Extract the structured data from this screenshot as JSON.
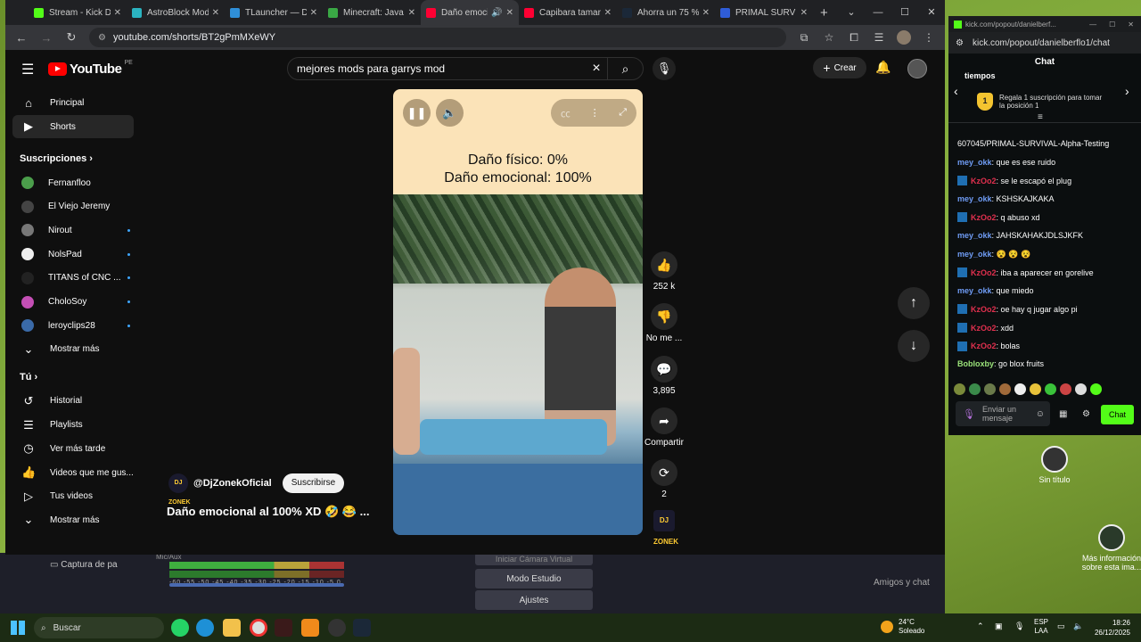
{
  "browser": {
    "tabs": [
      {
        "label": "Stream - Kick Das",
        "color": "#53fc18"
      },
      {
        "label": "AstroBlock ModPa",
        "color": "#2bb3c0"
      },
      {
        "label": "TLauncher — Do",
        "color": "#2f8fd8"
      },
      {
        "label": "Minecraft: Java y",
        "color": "#3aa845"
      },
      {
        "label": "Daño emocio",
        "color": "#ff0033",
        "active": true
      },
      {
        "label": "Capibara tamaras",
        "color": "#ff0033"
      },
      {
        "label": "Ahorra un 75 % e",
        "color": "#1b2838"
      },
      {
        "label": "PRIMAL SURV",
        "color": "#2f5dd8"
      }
    ],
    "url": "youtube.com/shorts/BT2gPmMXeWY"
  },
  "youtube": {
    "logo_text": "YouTube",
    "country": "PE",
    "search_query": "mejores mods para garrys mod",
    "create_label": "Crear",
    "sidebar": {
      "main": [
        {
          "label": "Principal",
          "icon": "home-icon"
        },
        {
          "label": "Shorts",
          "icon": "shorts-icon",
          "active": true
        }
      ],
      "subs_heading": "Suscripciones",
      "subs": [
        {
          "label": "Fernanfloo",
          "color": "#4b9e4b",
          "live": false
        },
        {
          "label": "El Viejo Jeremy",
          "color": "#444444",
          "live": false
        },
        {
          "label": "Nirout",
          "color": "#777777",
          "live": true
        },
        {
          "label": "NolsPad",
          "color": "#eeeeee",
          "live": true
        },
        {
          "label": "TITANS of CNC ...",
          "color": "#222222",
          "live": true
        },
        {
          "label": "CholoSoy",
          "color": "#c44fb5",
          "live": true
        },
        {
          "label": "leroyclips28",
          "color": "#3a6aa8",
          "live": true
        }
      ],
      "subs_more": "Mostrar más",
      "you_heading": "Tú",
      "you": [
        {
          "label": "Historial",
          "icon": "history-icon"
        },
        {
          "label": "Playlists",
          "icon": "playlists-icon"
        },
        {
          "label": "Ver más tarde",
          "icon": "clock-icon"
        },
        {
          "label": "Videos que me gus...",
          "icon": "thumbs-up-icon"
        },
        {
          "label": "Tus videos",
          "icon": "video-icon"
        }
      ],
      "you_more": "Mostrar más"
    },
    "short": {
      "caption_line1": "Daño físico: 0%",
      "caption_line2": "Daño emocional: 100%",
      "channel": "@DjZonekOficial",
      "channel_badge": "DJ ZONEK",
      "subscribe": "Suscribirse",
      "title": "Daño emocional al 100% XD 🤣 😂 ..."
    },
    "reactions": {
      "likes": "252 k",
      "dislike": "No me ...",
      "comments": "3,895",
      "share": "Compartir",
      "remix": "2"
    }
  },
  "kick": {
    "window_url": "kick.com/popout/danielberf...",
    "url": "kick.com/popout/danielberflo1/chat",
    "header": "Chat",
    "pinned_title": "tiempos",
    "pinned_badge": "1",
    "pinned_text": "Regala 1 suscripción para tomar la posición 1",
    "messages": [
      {
        "user": "",
        "text": "607045/PRIMAL-SURVIVAL-Alpha-Testing",
        "color": "#ffffff",
        "badge": false
      },
      {
        "user": "mey_okk",
        "text": ": que es ese ruido",
        "color": "#6f9cf5",
        "badge": false
      },
      {
        "user": "KzOo2",
        "text": ": se le escapó el plug",
        "color": "#e0304e",
        "badge": true
      },
      {
        "user": "mey_okk",
        "text": ": KSHSKAJKAKA",
        "color": "#6f9cf5",
        "badge": false
      },
      {
        "user": "KzOo2",
        "text": ": q abuso xd",
        "color": "#e0304e",
        "badge": true
      },
      {
        "user": "mey_okk",
        "text": ": JAHSKAHAKJDLSJKFK",
        "color": "#6f9cf5",
        "badge": false
      },
      {
        "user": "mey_okk",
        "text": ": 😵 😵 😵",
        "color": "#6f9cf5",
        "badge": false
      },
      {
        "user": "KzOo2",
        "text": ": iba a aparecer en gorelive",
        "color": "#e0304e",
        "badge": true
      },
      {
        "user": "mey_okk",
        "text": ": que miedo",
        "color": "#6f9cf5",
        "badge": false
      },
      {
        "user": "KzOo2",
        "text": ": oe hay q jugar algo pi",
        "color": "#e0304e",
        "badge": true
      },
      {
        "user": "KzOo2",
        "text": ": xdd",
        "color": "#e0304e",
        "badge": true
      },
      {
        "user": "KzOo2",
        "text": ": bolas",
        "color": "#e0304e",
        "badge": true
      },
      {
        "user": "Bobloxby",
        "text": ": go blox fruits",
        "color": "#9be37a",
        "badge": false
      }
    ],
    "input_placeholder": "Enviar un mensaje",
    "send_label": "Chat"
  },
  "obs": {
    "capture_label": "Captura de pa",
    "mixer_label": "Mic/Aux",
    "meter_scale": "-60 -55 -50 -45 -40 -35 -30 -25 -20 -15 -10 -5 0",
    "virtual_cam": "Iniciar Cámara Virtual",
    "studio_mode": "Modo Estudio",
    "settings": "Ajustes",
    "friends": "Amigos y chat"
  },
  "desktop": {
    "icon1": "Sin título",
    "icon2": "Más información sobre esta ima..."
  },
  "taskbar": {
    "search": "Buscar",
    "temp": "24°C",
    "weather": "Soleado",
    "lang1": "ESP",
    "lang2": "LAA",
    "time": "18:26",
    "date": "26/12/2025"
  }
}
